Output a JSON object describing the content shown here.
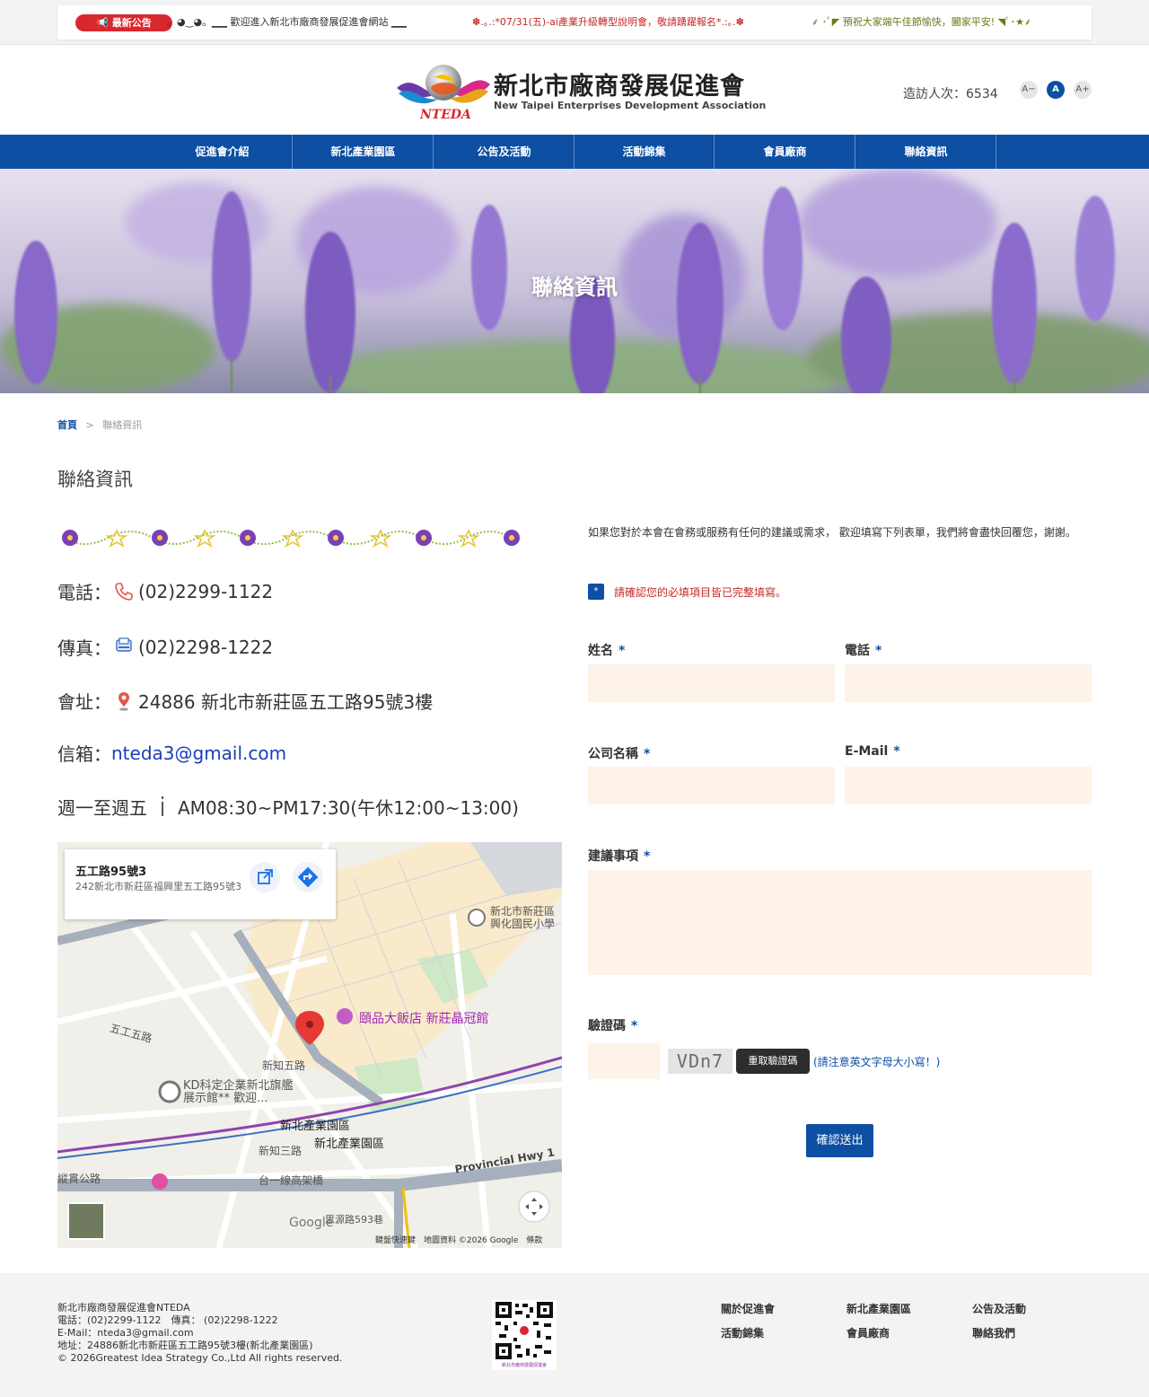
{
  "announcement": {
    "badge": "📢 最新公告",
    "items": [
      "。◕‿◕。▁▁ 歡迎進入新北市廠商發展促進會網站 ▁▁",
      "✽.｡.:*07/31(五)-ai產業升級轉型說明會，敬請踴躍報名*.:｡.✽",
      "⸙ ･ﾟ◤ 預祝大家端午佳節愉快，闔家平安! ◥ﾟ･★⸙"
    ]
  },
  "header": {
    "title": "新北市廠商發展促進會",
    "subtitle": "New Taipei Enterprises Development Association",
    "logo_text": "NTEDA",
    "visitors": "造訪人次：6534",
    "font_smaller": "A−",
    "font_normal": "A",
    "font_larger": "A+"
  },
  "nav": [
    "促進會介紹",
    "新北產業園區",
    "公告及活動",
    "活動錦集",
    "會員廠商",
    "聯絡資訊"
  ],
  "banner": {
    "title": "聯絡資訊"
  },
  "breadcrumb": {
    "home": "首頁",
    "sep": ">",
    "current": "聯絡資訊"
  },
  "page_title": "聯絡資訊",
  "contact": {
    "phone_label": "電話：",
    "phone": "(02)2299-1122",
    "fax_label": "傳真：",
    "fax": "(02)2298-1222",
    "address_label": "會址：",
    "address": "24886 新北市新莊區五工路95號3樓",
    "email_label": "信箱：",
    "email": "nteda3@gmail.com",
    "hours_label": "週一至週五",
    "hours": "AM08:30~PM17:30(午休12:00~13:00)"
  },
  "map": {
    "card_title": "五工路95號3",
    "card_address": "242新北市新莊區福興里五工路95號3",
    "labels": {
      "wugong5": "五工五路",
      "xinzhi5": "新知五路",
      "xinzhi3": "新知三路",
      "park": "新北產業園區",
      "park2": "新北產業園區",
      "hotel": "頤品大飯店 新莊晶冠館",
      "kd": "KD科定企業新北旗艦展示館** 歡迎...",
      "school": "新北市新莊區興化國民小學",
      "hwy": "Provincial Hwy 1",
      "tai1": "台一線高架橋",
      "zongguan": "縱貫公路",
      "sy": "思源路593巷",
      "google": "Google"
    },
    "footer": "鍵盤快速鍵　地圖資料 ©2026 Google　條款"
  },
  "form": {
    "intro": "如果您對於本會在會務或服務有任何的建議或需求， 歡迎填寫下列表單，我們將會盡快回覆您，謝謝。",
    "warning": "請確認您的必填項目皆已完整填寫。",
    "warning_icon": "*",
    "name_label": "姓名",
    "phone_label": "電話",
    "company_label": "公司名稱",
    "email_label": "E-Mail",
    "suggest_label": "建議事項",
    "captcha_label": "驗證碼",
    "req": "*",
    "captcha_code": "VDn7",
    "captcha_refresh": "重取驗證碼",
    "captcha_note": "(請注意英文字母大小寫！)",
    "submit": "確認送出"
  },
  "footer": {
    "lines": [
      "新北市廠商發展促進會NTEDA",
      "電話：(02)2299-1122　傳真： (02)2298-1222",
      "E-Mail：nteda3@gmail.com",
      "地址：24886新北市新莊區五工路95號3樓(新北產業園區)",
      "© 2026Greatest Idea Strategy Co.,Ltd All rights reserved."
    ],
    "qr_caption": "新北市廠商發展促進會",
    "links": [
      "關於促進會",
      "新北產業園區",
      "公告及活動",
      "活動錦集",
      "會員廠商",
      "聯絡我們"
    ]
  },
  "colors": {
    "brand_blue": "#0c4fa3",
    "alert_red": "#d9272e",
    "input_bg": "#fdf3e8"
  }
}
